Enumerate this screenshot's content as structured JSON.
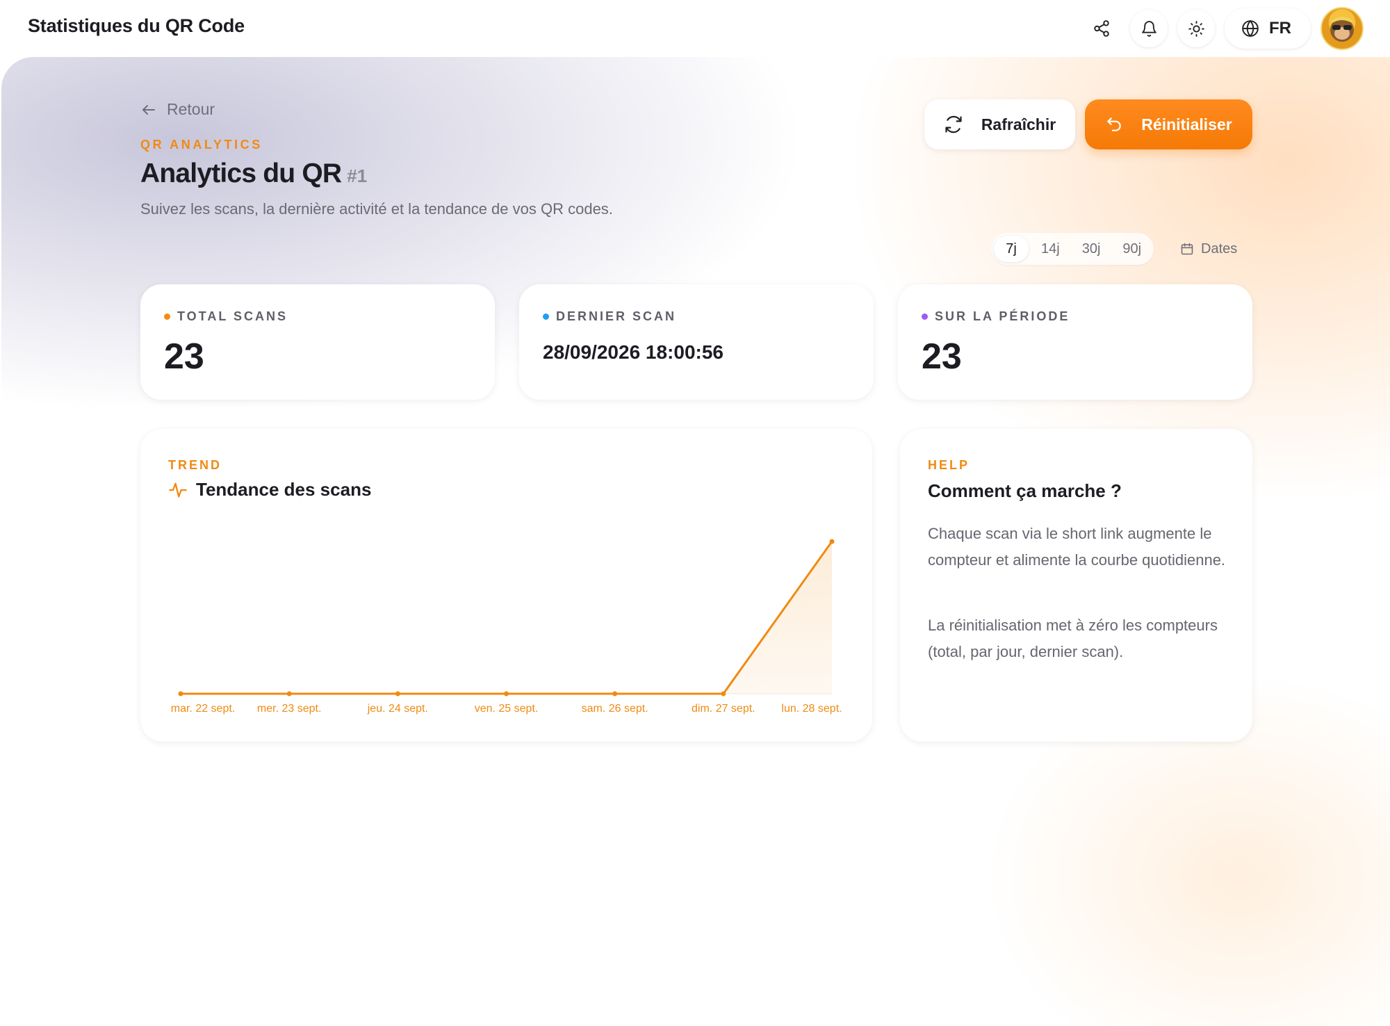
{
  "app": {
    "title": "Statistiques du QR Code",
    "language": "FR"
  },
  "header": {
    "back_label": "Retour",
    "eyebrow": "QR ANALYTICS",
    "title": "Analytics du QR",
    "title_id": "#1",
    "subtitle": "Suivez les scans, la dernière activité et la tendance de vos QR codes.",
    "refresh_label": "Rafraîchir",
    "reset_label": "Réinitialiser"
  },
  "range": {
    "options": [
      "7j",
      "14j",
      "30j",
      "90j"
    ],
    "selected": "7j",
    "dates_label": "Dates"
  },
  "stats": [
    {
      "label": "TOTAL SCANS",
      "value": "23",
      "dot_color": "#f58a12"
    },
    {
      "label": "DERNIER SCAN",
      "value": "28/09/2026 18:00:56",
      "dot_color": "#1ea0f0"
    },
    {
      "label": "SUR LA PÉRIODE",
      "value": "23",
      "dot_color": "#9b5cf0"
    }
  ],
  "trend": {
    "eyebrow": "TREND",
    "title": "Tendance des scans"
  },
  "help": {
    "eyebrow": "HELP",
    "title": "Comment ça marche ?",
    "paragraph_1": "Chaque scan via le short link augmente le compteur et alimente la courbe quotidienne.",
    "paragraph_2": "La réinitialisation met à zéro les compteurs (total, par jour, dernier scan)."
  },
  "colors": {
    "accent": "#f57a06",
    "accent_text": "#f08a12"
  },
  "chart_data": {
    "type": "area",
    "title": "Tendance des scans",
    "categories": [
      "mar. 22 sept.",
      "mer. 23 sept.",
      "jeu. 24 sept.",
      "ven. 25 sept.",
      "sam. 26 sept.",
      "dim. 27 sept.",
      "lun. 28 sept."
    ],
    "series": [
      {
        "values": [
          0,
          0,
          0,
          0,
          0,
          0,
          23
        ]
      }
    ],
    "ylim": [
      0,
      23
    ],
    "grid": false,
    "legend": "none"
  }
}
